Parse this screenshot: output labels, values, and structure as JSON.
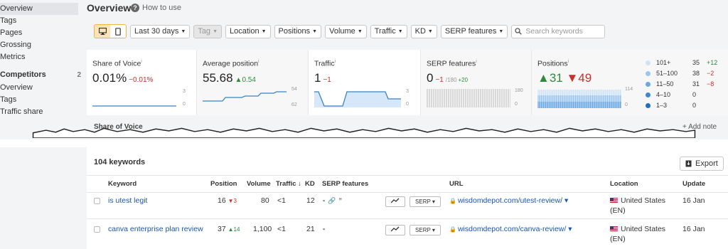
{
  "sidebar": {
    "top_items": [
      "Overview",
      "Tags",
      "Pages",
      "Grossing",
      "Metrics"
    ],
    "competitors_label": "Competitors",
    "competitors_count": "2",
    "competitor_items": [
      "Overview",
      "Tags",
      "Traffic share"
    ]
  },
  "header": {
    "title": "Overview",
    "howto": "How to use"
  },
  "filters": {
    "date": "Last 30 days",
    "tag": "Tag",
    "location": "Location",
    "positions": "Positions",
    "volume": "Volume",
    "traffic": "Traffic",
    "kd": "KD",
    "serp_features": "SERP features",
    "search_placeholder": "Search keywords"
  },
  "metrics": {
    "sov": {
      "title": "Share of Voice",
      "value": "0.01%",
      "delta": "−0.01%",
      "axis_top": "3",
      "axis_bottom": "0"
    },
    "avg_pos": {
      "title": "Average position",
      "value": "55.68",
      "delta": "▲0.54",
      "axis_top": "54",
      "axis_bottom": "62"
    },
    "traffic": {
      "title": "Traffic",
      "value": "1",
      "delta": "−1",
      "axis_top": "3",
      "axis_bottom": "0"
    },
    "serp": {
      "title": "SERP features",
      "value": "0",
      "delta": "−1",
      "of": "/180",
      "plus": "+20",
      "axis_top": "180",
      "axis_bottom": "0"
    },
    "positions": {
      "title": "Positions",
      "up": "▲31",
      "down": "▼49",
      "axis_top": "114",
      "axis_bottom": "0",
      "legend": [
        {
          "label": "101+",
          "count": "35",
          "delta": "+12",
          "color": "#cfe3f6",
          "dclass": "pos"
        },
        {
          "label": "51–100",
          "count": "38",
          "delta": "−2",
          "color": "#9cc6ee",
          "dclass": "neg"
        },
        {
          "label": "11–50",
          "count": "31",
          "delta": "−8",
          "color": "#6aa8e4",
          "dclass": "neg"
        },
        {
          "label": "4–10",
          "count": "0",
          "delta": "",
          "color": "#3d88d6",
          "dclass": ""
        },
        {
          "label": "1–3",
          "count": "0",
          "delta": "",
          "color": "#1f6fc4",
          "dclass": ""
        }
      ]
    }
  },
  "tear": {
    "sov_label": "Share of Voice",
    "addnote": "+ Add note"
  },
  "table": {
    "count_label": "104 keywords",
    "export_label": "Export",
    "headers": {
      "keyword": "Keyword",
      "position": "Position",
      "volume": "Volume",
      "traffic": "Traffic ↓",
      "kd": "KD",
      "serp": "SERP features",
      "url": "URL",
      "location": "Location",
      "update": "Update"
    },
    "rows": [
      {
        "keyword": "is utest legit",
        "position": "16",
        "pos_delta": "▼3",
        "pos_class": "neg",
        "volume": "80",
        "traffic": "<1",
        "kd": "12",
        "serp_btn": "SERP ▾",
        "url": "wisdomdepot.com/utest-review/ ▾",
        "location": "United States",
        "location2": "(EN)",
        "update": "16 Jan"
      },
      {
        "keyword": "canva enterprise plan review",
        "position": "37",
        "pos_delta": "▲14",
        "pos_class": "pos",
        "volume": "1,100",
        "traffic": "<1",
        "kd": "21",
        "serp_btn": "SERP ▾",
        "url": "wisdomdepot.com/canva-review/ ▾",
        "location": "United States",
        "location2": "(EN)",
        "update": "16 Jan"
      }
    ]
  }
}
